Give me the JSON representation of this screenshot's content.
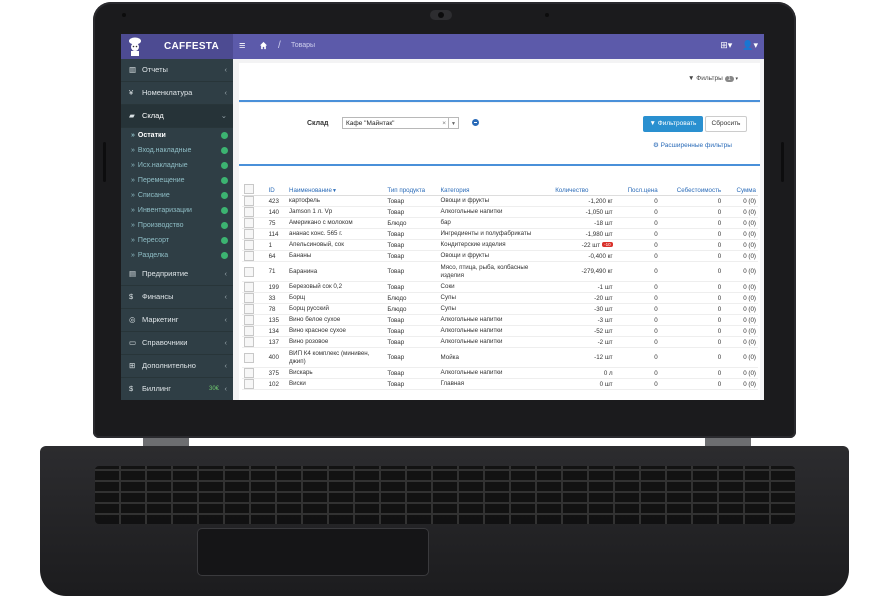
{
  "app": {
    "brand": "CAFFESTA",
    "breadcrumb": "Товары"
  },
  "sidebar": {
    "items": [
      {
        "icon": "bar-chart-icon",
        "label": "Отчеты"
      },
      {
        "icon": "fork-knife-icon",
        "label": "Номенклатура"
      },
      {
        "icon": "truck-icon",
        "label": "Склад"
      }
    ],
    "subitems": [
      {
        "label": "Остатки",
        "current": true
      },
      {
        "label": "Вход.накладные"
      },
      {
        "label": "Исх.накладные"
      },
      {
        "label": "Перемещение"
      },
      {
        "label": "Списание"
      },
      {
        "label": "Инвентаризации"
      },
      {
        "label": "Производство"
      },
      {
        "label": "Пересорт"
      },
      {
        "label": "Разделка"
      }
    ],
    "items2": [
      {
        "icon": "building-icon",
        "label": "Предприятие"
      },
      {
        "icon": "dollar-icon",
        "label": "Финансы"
      },
      {
        "icon": "target-icon",
        "label": "Маркетинг"
      },
      {
        "icon": "book-icon",
        "label": "Справочники"
      },
      {
        "icon": "plus-square-icon",
        "label": "Дополнительно"
      },
      {
        "icon": "dollar-icon",
        "label": "Биллинг",
        "extra": "30€"
      }
    ]
  },
  "filters": {
    "toggle_label": "Фильтры",
    "count": "1",
    "warehouse_label": "Склад",
    "warehouse_value": "Кафе \"Майнтак\"",
    "filter_button": "Фильтровать",
    "reset_button": "Сбросить",
    "advanced_link": "Расширенные фильтры"
  },
  "table": {
    "headers": {
      "id": "ID",
      "name": "Наименование",
      "type": "Тип продукта",
      "category": "Категория",
      "qty": "Количество",
      "last_price": "Посл.цена",
      "cost": "Себестоимость",
      "sum": "Сумма"
    },
    "rows": [
      {
        "id": "423",
        "name": "картофель",
        "type": "Товар",
        "category": "Овощи и фрукты",
        "qty": "-1,200 кг",
        "last": "0",
        "cost": "0",
        "sum": "0 (0)"
      },
      {
        "id": "140",
        "name": "Jamson 1 л. Vp",
        "type": "Товар",
        "category": "Алкогольные напитки",
        "qty": "-1,050 шт",
        "last": "0",
        "cost": "0",
        "sum": "0 (0)"
      },
      {
        "id": "75",
        "name": "Американо с молоком",
        "type": "Блюдо",
        "category": "бар",
        "qty": "-18 шт",
        "last": "0",
        "cost": "0",
        "sum": "0 (0)"
      },
      {
        "id": "114",
        "name": "ананас конс. 565 г.",
        "type": "Товар",
        "category": "Ингредиенты и полуфабрикаты",
        "qty": "-1,980 шт",
        "last": "0",
        "cost": "0",
        "sum": "0 (0)"
      },
      {
        "id": "1",
        "name": "Апельсиновый, сок",
        "type": "Товар",
        "category": "Кондитерские изделия",
        "qty": "-22 шт",
        "badge": "-10",
        "last": "0",
        "cost": "0",
        "sum": "0 (0)"
      },
      {
        "id": "64",
        "name": "Бананы",
        "type": "Товар",
        "category": "Овощи и фрукты",
        "qty": "-0,400 кг",
        "last": "0",
        "cost": "0",
        "sum": "0 (0)"
      },
      {
        "id": "71",
        "name": "Баранина",
        "type": "Товар",
        "category": "Мясо, птица, рыба, колбасные изделия",
        "qty": "-279,490 кг",
        "last": "0",
        "cost": "0",
        "sum": "0 (0)",
        "tall": true
      },
      {
        "id": "199",
        "name": "Березовый сок 0,2",
        "type": "Товар",
        "category": "Соки",
        "qty": "-1 шт",
        "last": "0",
        "cost": "0",
        "sum": "0 (0)"
      },
      {
        "id": "33",
        "name": "Борщ",
        "type": "Блюдо",
        "category": "Супы",
        "qty": "-20 шт",
        "last": "0",
        "cost": "0",
        "sum": "0 (0)"
      },
      {
        "id": "78",
        "name": "Борщ русский",
        "type": "Блюдо",
        "category": "Супы",
        "qty": "-30 шт",
        "last": "0",
        "cost": "0",
        "sum": "0 (0)"
      },
      {
        "id": "135",
        "name": "Вино белое сухое",
        "type": "Товар",
        "category": "Алкогольные напитки",
        "qty": "-3 шт",
        "last": "0",
        "cost": "0",
        "sum": "0 (0)"
      },
      {
        "id": "134",
        "name": "Вино красное сухое",
        "type": "Товар",
        "category": "Алкогольные напитки",
        "qty": "-52 шт",
        "last": "0",
        "cost": "0",
        "sum": "0 (0)"
      },
      {
        "id": "137",
        "name": "Вино розовое",
        "type": "Товар",
        "category": "Алкогольные напитки",
        "qty": "-2 шт",
        "last": "0",
        "cost": "0",
        "sum": "0 (0)"
      },
      {
        "id": "400",
        "name": "ВИП К4 комплекс (минивен, джип)",
        "type": "Товар",
        "category": "Мойка",
        "qty": "-12 шт",
        "last": "0",
        "cost": "0",
        "sum": "0 (0)",
        "tall": true
      },
      {
        "id": "375",
        "name": "Вискарь",
        "type": "Товар",
        "category": "Алкогольные напитки",
        "qty": "0 л",
        "last": "0",
        "cost": "0",
        "sum": "0 (0)"
      },
      {
        "id": "102",
        "name": "Виски",
        "type": "Товар",
        "category": "Главная",
        "qty": "0 шт",
        "last": "0",
        "cost": "0",
        "sum": "0 (0)"
      }
    ]
  }
}
